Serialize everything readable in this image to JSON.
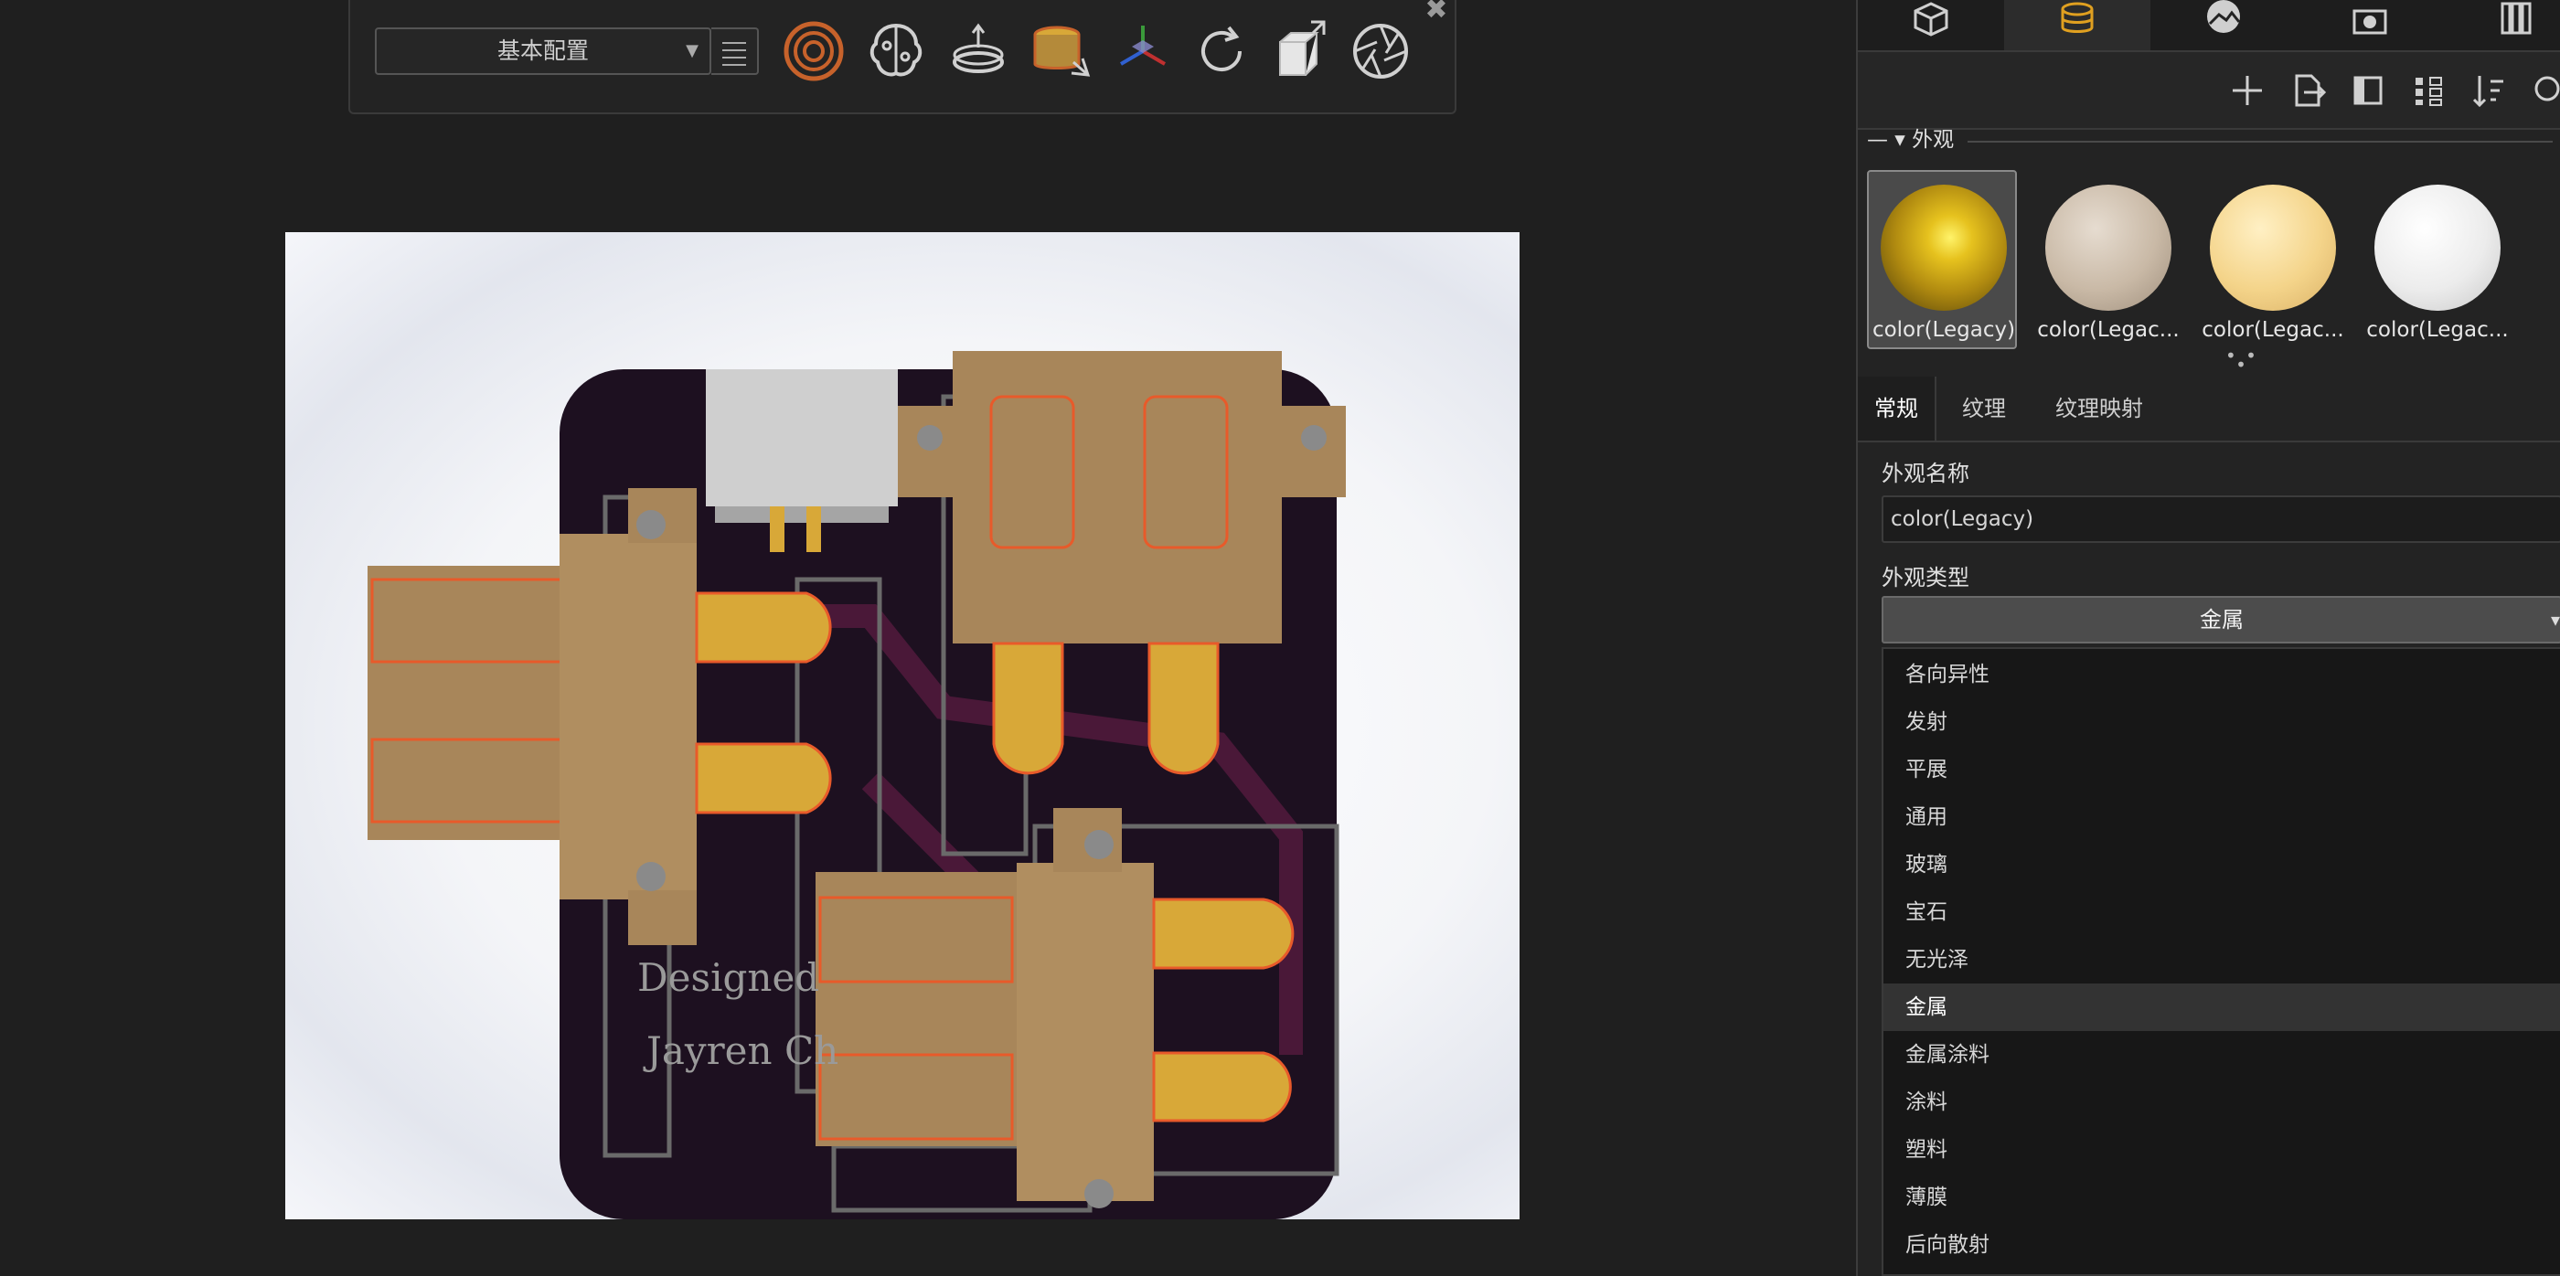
{
  "toolbar": {
    "config_value": "基本配置",
    "icons": [
      "display-states-icon",
      "ai-icon",
      "turntable-icon",
      "appearance-icon",
      "axis-icon",
      "refresh-icon",
      "export-box-icon",
      "camera-aperture-icon"
    ]
  },
  "viewport": {
    "pcb_text_line1": "Designed",
    "pcb_text_line2": "Jayren Ch",
    "background_color": "#f4f5f8",
    "board_color": "#1d1020",
    "connector_color": "#a8865a",
    "pin_color": "#d8a838",
    "outline_color": "#e85a2a"
  },
  "panel": {
    "tabs": [
      "model-icon",
      "appearance-db-icon",
      "scene-icon",
      "camera-icon",
      "library-icon"
    ],
    "active_tab": 1,
    "tools": [
      "add-icon",
      "export-icon",
      "layout-icon",
      "grid-view-icon",
      "sort-icon",
      "search-icon"
    ],
    "section_title": "外观",
    "swatches": [
      {
        "label": "color(Legacy)",
        "color": "#d4b21a"
      },
      {
        "label": "color(Legac...",
        "color": "#c9b9a6"
      },
      {
        "label": "color(Legac...",
        "color": "#f4d48a"
      },
      {
        "label": "color(Legac...",
        "color": "#e8e8e8"
      }
    ],
    "subtabs": [
      "常规",
      "纹理",
      "纹理映射"
    ],
    "name_label": "外观名称",
    "name_value": "color(Legacy)",
    "type_label": "外观类型",
    "type_value": "金属",
    "type_options": [
      "各向异性",
      "发射",
      "平展",
      "通用",
      "玻璃",
      "宝石",
      "无光泽",
      "金属",
      "金属涂料",
      "涂料",
      "塑料",
      "薄膜",
      "后向散射"
    ],
    "selected_option": "金属"
  }
}
